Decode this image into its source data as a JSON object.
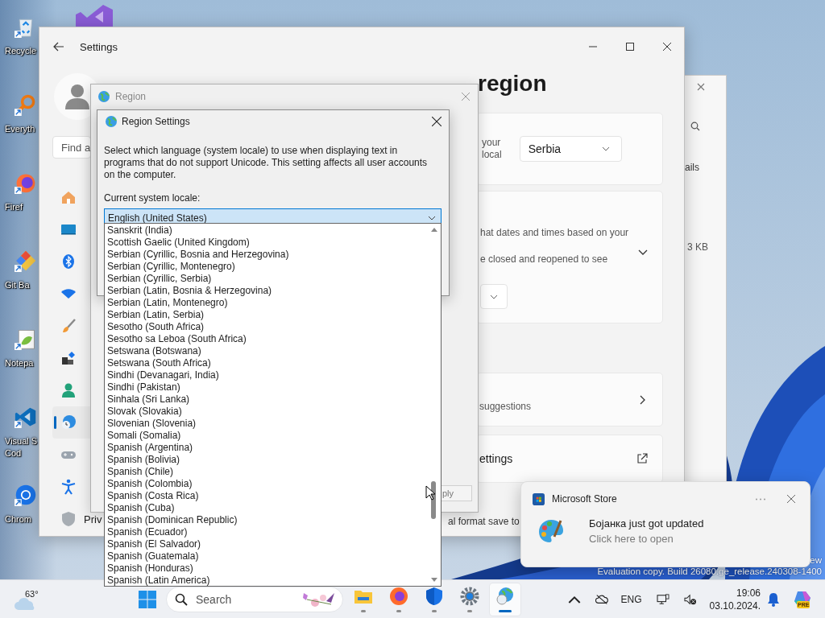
{
  "desktop": {
    "icons": [
      {
        "kind": "recycle",
        "lines": [
          "Recycle"
        ]
      },
      {
        "kind": "everything",
        "lines": [
          "Everyth"
        ]
      },
      {
        "kind": "firefox",
        "lines": [
          "Firef"
        ]
      },
      {
        "kind": "git",
        "lines": [
          "Git Ba"
        ]
      },
      {
        "kind": "notepad",
        "lines": [
          "Notepa"
        ]
      },
      {
        "kind": "vscode",
        "lines": [
          "Visual S",
          "Cod"
        ]
      },
      {
        "kind": "chrome",
        "lines": [
          "Chrom"
        ]
      }
    ],
    "watermark": [
      "ew",
      "Evaluation copy. Build 26080.ge_release.240308-1400"
    ]
  },
  "settings": {
    "title": "Settings",
    "search": {
      "placeholder": "Find a"
    },
    "nav": [
      {
        "kind": "home",
        "selected": false
      },
      {
        "kind": "system",
        "selected": false
      },
      {
        "kind": "bluetooth",
        "selected": false
      },
      {
        "kind": "network",
        "selected": false
      },
      {
        "kind": "brush",
        "selected": false
      },
      {
        "kind": "apps",
        "selected": false
      },
      {
        "kind": "accounts",
        "selected": false
      },
      {
        "kind": "time",
        "selected": true
      },
      {
        "kind": "gaming",
        "selected": false
      },
      {
        "kind": "accessibility",
        "selected": false
      },
      {
        "kind": "privacy",
        "label": "Priv",
        "selected": false
      }
    ],
    "heading": "region",
    "country_card": {
      "lines": [
        "your",
        "local"
      ],
      "value": "Serbia"
    },
    "format_card": {
      "lines": [
        "hat dates and times based on your",
        "e closed and reopened to see"
      ]
    },
    "suggestions_card": {
      "text": "suggestions"
    },
    "link_card": {
      "text": "ettings"
    },
    "footer_text": "al format save to"
  },
  "behind_window": {
    "texts": [
      "ails",
      "3 KB"
    ]
  },
  "region_window": {
    "title": "Region",
    "apply_button": "ply"
  },
  "dialog": {
    "title": "Region Settings",
    "description": "Select which language (system locale) to use when displaying text in programs that do not support Unicode. This setting affects all user accounts on the computer.",
    "locale_label": "Current system locale:",
    "locale_value": "English (United States)",
    "options": [
      {
        "label": "Sanskrit (India)",
        "selected": false
      },
      {
        "label": "Scottish Gaelic (United Kingdom)",
        "selected": false
      },
      {
        "label": "Serbian (Cyrillic, Bosnia and Herzegovina)",
        "selected": false
      },
      {
        "label": "Serbian (Cyrillic, Montenegro)",
        "selected": false
      },
      {
        "label": "Serbian (Cyrillic, Serbia)",
        "selected": false
      },
      {
        "label": "Serbian (Latin, Bosnia & Herzegovina)",
        "selected": false
      },
      {
        "label": "Serbian (Latin, Montenegro)",
        "selected": false
      },
      {
        "label": "Serbian (Latin, Serbia)",
        "selected": false
      },
      {
        "label": "Sesotho (South Africa)",
        "selected": false
      },
      {
        "label": "Sesotho sa Leboa (South Africa)",
        "selected": false
      },
      {
        "label": "Setswana (Botswana)",
        "selected": false
      },
      {
        "label": "Setswana (South Africa)",
        "selected": false
      },
      {
        "label": "Sindhi (Devanagari, India)",
        "selected": false
      },
      {
        "label": "Sindhi (Pakistan)",
        "selected": false
      },
      {
        "label": "Sinhala (Sri Lanka)",
        "selected": false
      },
      {
        "label": "Slovak (Slovakia)",
        "selected": false
      },
      {
        "label": "Slovenian (Slovenia)",
        "selected": false
      },
      {
        "label": "Somali (Somalia)",
        "selected": false
      },
      {
        "label": "Spanish (Argentina)",
        "selected": false
      },
      {
        "label": "Spanish (Bolivia)",
        "selected": false
      },
      {
        "label": "Spanish (Chile)",
        "selected": false
      },
      {
        "label": "Spanish (Colombia)",
        "selected": false
      },
      {
        "label": "Spanish (Costa Rica)",
        "selected": false
      },
      {
        "label": "Spanish (Cuba)",
        "selected": false
      },
      {
        "label": "Spanish (Dominican Republic)",
        "selected": false
      },
      {
        "label": "Spanish (Ecuador)",
        "selected": false
      },
      {
        "label": "Spanish (El Salvador)",
        "selected": false
      },
      {
        "label": "Spanish (Guatemala)",
        "selected": false
      },
      {
        "label": "Spanish (Honduras)",
        "selected": false
      },
      {
        "label": "Spanish (Latin America)",
        "selected": false
      }
    ]
  },
  "toast": {
    "app": "Microsoft Store",
    "title": "Бојанка just got updated",
    "subtitle": "Click here to open"
  },
  "taskbar": {
    "weather": "63°",
    "search": {
      "placeholder": "Search"
    },
    "apps": [
      {
        "kind": "explorer",
        "active": false
      },
      {
        "kind": "firefox",
        "active": false
      },
      {
        "kind": "defender",
        "active": false
      },
      {
        "kind": "settings",
        "active": false
      },
      {
        "kind": "region",
        "active": true
      }
    ],
    "language": "ENG",
    "time": "19:06",
    "date": "03.10.2024.",
    "copilot_badge": "PRE"
  }
}
